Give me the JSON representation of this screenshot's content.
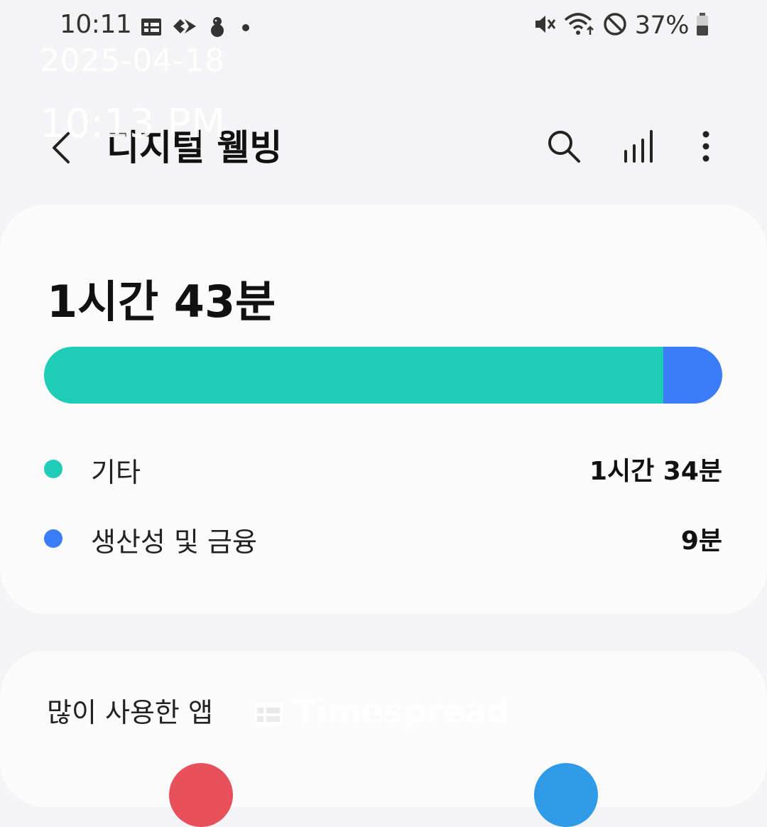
{
  "status_bar": {
    "time": "10:11",
    "battery": "37%"
  },
  "overlay": {
    "date": "2025-04-18",
    "time": "10:13 PM"
  },
  "header": {
    "title": "디지털 웰빙",
    "icons": [
      "back-icon",
      "search-icon",
      "bar-chart-icon",
      "more-vertical-icon"
    ]
  },
  "summary": {
    "total": "1시간 43분",
    "categories": [
      {
        "label": "기타",
        "value": "1시간 34분",
        "minutes": 94,
        "color": "#1fcdb7"
      },
      {
        "label": "생산성 및 금융",
        "value": "9분",
        "minutes": 9,
        "color": "#3b7cfb"
      }
    ]
  },
  "apps": {
    "heading": "많이 사용한 앱"
  },
  "watermark": {
    "text": "Timespread"
  }
}
